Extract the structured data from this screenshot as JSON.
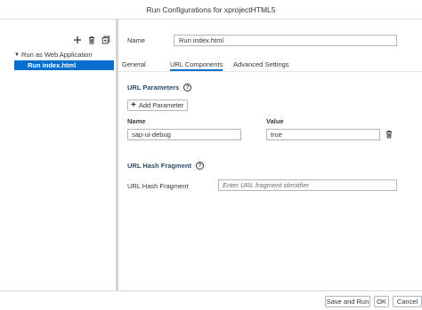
{
  "window": {
    "title": "Run Configurations for xprojectHTML5"
  },
  "left_toolbar": {
    "icons": [
      "add-icon",
      "delete-icon",
      "copy-icon"
    ]
  },
  "tree": {
    "group_label": "Run as Web Application",
    "items": [
      {
        "label": "Run index.html",
        "selected": true
      }
    ]
  },
  "config": {
    "name_label": "Name",
    "name_value": "Run index.html"
  },
  "tabs": [
    {
      "label": "General",
      "active": false
    },
    {
      "label": "URL Components",
      "active": true
    },
    {
      "label": "Advanced Settings",
      "active": false
    }
  ],
  "url_parameters": {
    "title": "URL Parameters",
    "add_button_label": "Add Parameter",
    "col_name": "Name",
    "col_value": "Value",
    "rows": [
      {
        "name": "sap-ui-debug",
        "value": "true"
      }
    ]
  },
  "url_hash": {
    "title": "URL Hash Fragment",
    "field_label": "URL Hash Fragment",
    "placeholder": "Enter URL fragment identifier"
  },
  "footer": {
    "save_run_label": "Save and Run",
    "ok_label": "OK",
    "cancel_label": "Cancel"
  },
  "colors": {
    "accent": "#0a6ed1",
    "section_title": "#2c4e6c"
  }
}
